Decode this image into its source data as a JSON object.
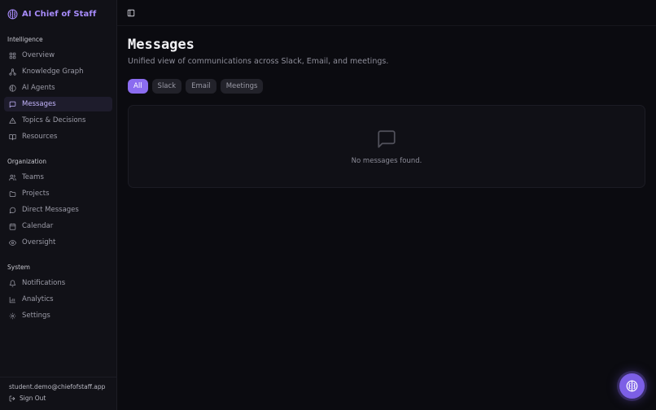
{
  "brand": {
    "title": "AI Chief of Staff",
    "icon": "brain-icon",
    "accent": "#a78bfa"
  },
  "sidebar": {
    "sections": [
      {
        "label": "Intelligence",
        "items": [
          {
            "label": "Overview",
            "icon": "grid-icon"
          },
          {
            "label": "Knowledge Graph",
            "icon": "graph-icon"
          },
          {
            "label": "AI Agents",
            "icon": "brain-icon"
          },
          {
            "label": "Messages",
            "icon": "message-square-icon",
            "active": true
          },
          {
            "label": "Topics & Decisions",
            "icon": "triangle-icon"
          },
          {
            "label": "Resources",
            "icon": "book-icon"
          }
        ]
      },
      {
        "label": "Organization",
        "items": [
          {
            "label": "Teams",
            "icon": "users-icon"
          },
          {
            "label": "Projects",
            "icon": "folder-icon"
          },
          {
            "label": "Direct Messages",
            "icon": "message-circle-icon"
          },
          {
            "label": "Calendar",
            "icon": "calendar-icon"
          },
          {
            "label": "Oversight",
            "icon": "eye-icon"
          }
        ]
      },
      {
        "label": "System",
        "items": [
          {
            "label": "Notifications",
            "icon": "bell-icon"
          },
          {
            "label": "Analytics",
            "icon": "bar-chart-icon"
          },
          {
            "label": "Settings",
            "icon": "gear-icon"
          }
        ]
      }
    ],
    "footer": {
      "email": "student.demo@chiefofstaff.app",
      "sign_out": "Sign Out"
    }
  },
  "main": {
    "title": "Messages",
    "subtitle": "Unified view of communications across Slack, Email, and meetings.",
    "tabs": [
      {
        "label": "All",
        "active": true
      },
      {
        "label": "Slack"
      },
      {
        "label": "Email"
      },
      {
        "label": "Meetings"
      }
    ],
    "empty_state": "No messages found."
  },
  "colors": {
    "accent": "#8b6cf0",
    "background": "#0b0b10",
    "sidebar": "#111117"
  }
}
